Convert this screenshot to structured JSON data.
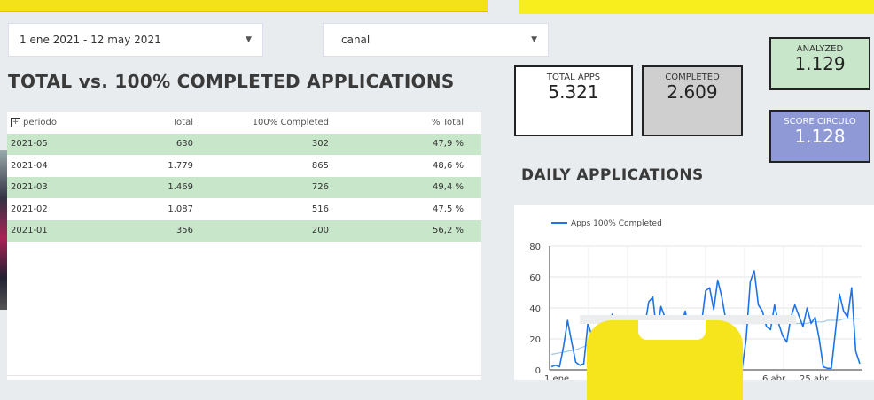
{
  "filters": {
    "date_range": "1 ene 2021 - 12 may 2021",
    "channel": "canal"
  },
  "left_title": "TOTAL vs. 100% COMPLETED APPLICATIONS",
  "table": {
    "headers": [
      "periodo",
      "Total",
      "100% Completed",
      "% Total"
    ],
    "rows": [
      {
        "periodo": "2021-05",
        "total": "630",
        "completed": "302",
        "pct": "47,9 %"
      },
      {
        "periodo": "2021-04",
        "total": "1.779",
        "completed": "865",
        "pct": "48,6 %"
      },
      {
        "periodo": "2021-03",
        "total": "1.469",
        "completed": "726",
        "pct": "49,4 %"
      },
      {
        "periodo": "2021-02",
        "total": "1.087",
        "completed": "516",
        "pct": "47,5 %"
      },
      {
        "periodo": "2021-01",
        "total": "356",
        "completed": "200",
        "pct": "56,2 %"
      }
    ]
  },
  "kpis": {
    "total_apps": {
      "label": "TOTAL APPS",
      "value": "5.321"
    },
    "completed": {
      "label": "COMPLETED",
      "value": "2.609"
    },
    "analyzed": {
      "label": "ANALYZED",
      "value": "1.129"
    },
    "score": {
      "label": "SCORE CIRCULO",
      "value": "1.128"
    }
  },
  "colors": {
    "analyzed_bg": "#c8e6c9",
    "score_bg": "#8e99d6",
    "completed_bg": "#cfcfcf",
    "line": "#1e73e8",
    "trend": "#9ec8ea"
  },
  "chart_title": "DAILY APPLICATIONS",
  "chart_data": {
    "type": "line",
    "series": [
      {
        "name": "Apps 100% Completed",
        "values": [
          2,
          3,
          2,
          15,
          32,
          18,
          5,
          3,
          4,
          30,
          22,
          14,
          25,
          18,
          28,
          36,
          20,
          12,
          10,
          16,
          24,
          19,
          30,
          28,
          44,
          47,
          22,
          41,
          34,
          18,
          20,
          26,
          29,
          38,
          22,
          26,
          28,
          30,
          51,
          53,
          39,
          58,
          47,
          32,
          18,
          16,
          2,
          1,
          20,
          57,
          64,
          42,
          38,
          28,
          26,
          42,
          30,
          22,
          18,
          34,
          42,
          35,
          28,
          40,
          30,
          34,
          20,
          2,
          1,
          1,
          25,
          49,
          38,
          34,
          53,
          12,
          4
        ]
      },
      {
        "name": "",
        "values": [
          10,
          10.5,
          11,
          11.5,
          12,
          12.5,
          13,
          14,
          15,
          16,
          17,
          18,
          19,
          20,
          21,
          22,
          23,
          24,
          25,
          25.5,
          26,
          26.5,
          27,
          27.5,
          28,
          28.5,
          29,
          29,
          29.5,
          29.5,
          30,
          30,
          30,
          30,
          30,
          30,
          30,
          30,
          30,
          30,
          30,
          30,
          30,
          30,
          30,
          30,
          30,
          30,
          30,
          30,
          30,
          30,
          30,
          30,
          30,
          30,
          30,
          30,
          30,
          30,
          30,
          30,
          30,
          30,
          31,
          31,
          31,
          31,
          32,
          32,
          32,
          32,
          33,
          33,
          33,
          33,
          33
        ]
      }
    ],
    "y_ticks": [
      "0",
      "20",
      "40",
      "60",
      "80"
    ],
    "ylim": [
      0,
      80
    ],
    "x_tick_labels": [
      "1 ene",
      "6 abr",
      "25 abr"
    ],
    "legend_position": "top-left",
    "grid": true
  }
}
